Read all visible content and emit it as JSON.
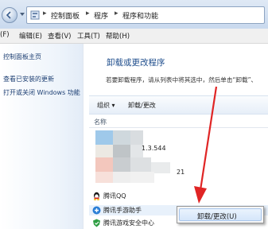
{
  "address_bar": {
    "crumbs": [
      "控制面板",
      "程序",
      "程序和功能"
    ],
    "separator": "▸"
  },
  "menubar": {
    "items": [
      "编辑(E)",
      "查看(V)",
      "工具(T)",
      "帮助(H)"
    ],
    "first_partial": "(F)"
  },
  "left_pane": {
    "links": [
      "控制面板主页",
      "查看已安装的更新",
      "打开或关闭 Windows 功能"
    ]
  },
  "main": {
    "title": "卸载或更改程序",
    "description": "若要卸载程序，请从列表中将其选中，然后单击“卸载”、",
    "toolbar": {
      "organize": "组织 ▾",
      "uninstall_change": "卸载/更改"
    },
    "column_header": "名称",
    "programs": [
      {
        "name": "1.3.544",
        "icon": "blurred-app-icon"
      },
      {
        "name": "21",
        "icon": "blurred-app-icon"
      },
      {
        "name": "腾讯QQ",
        "icon": "qq-penguin-icon"
      },
      {
        "name": "腾讯手游助手",
        "icon": "tencent-mobile-game-icon"
      },
      {
        "name": "腾讯游戏安全中心",
        "icon": "tencent-game-security-icon"
      }
    ]
  },
  "context_menu": {
    "item": "卸载/更改(U)"
  },
  "colors": {
    "annotation_arrow": "#e02525",
    "title_blue": "#1e4d8c",
    "link_blue": "#1d3f73"
  }
}
